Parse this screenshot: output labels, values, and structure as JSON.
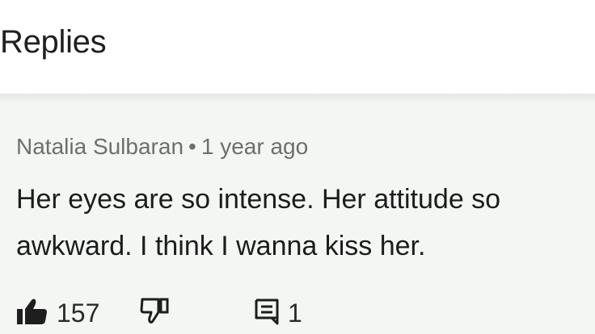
{
  "header": {
    "title": "Replies"
  },
  "comment": {
    "author": "Natalia Sulbaran",
    "separator": "•",
    "time": "1 year ago",
    "text": "Her eyes are so intense. Her attitude so\nawkward. I think I wanna kiss her.",
    "likes": "157",
    "replies": "1"
  },
  "icons": {
    "like": "thumbs-up-icon",
    "dislike": "thumbs-down-icon",
    "reply": "reply-comment-icon"
  },
  "colors": {
    "background": "#ffffff",
    "comment_background": "#f3f6f3",
    "meta_text": "#6e6e6e",
    "body_text": "#1c1c1c"
  }
}
